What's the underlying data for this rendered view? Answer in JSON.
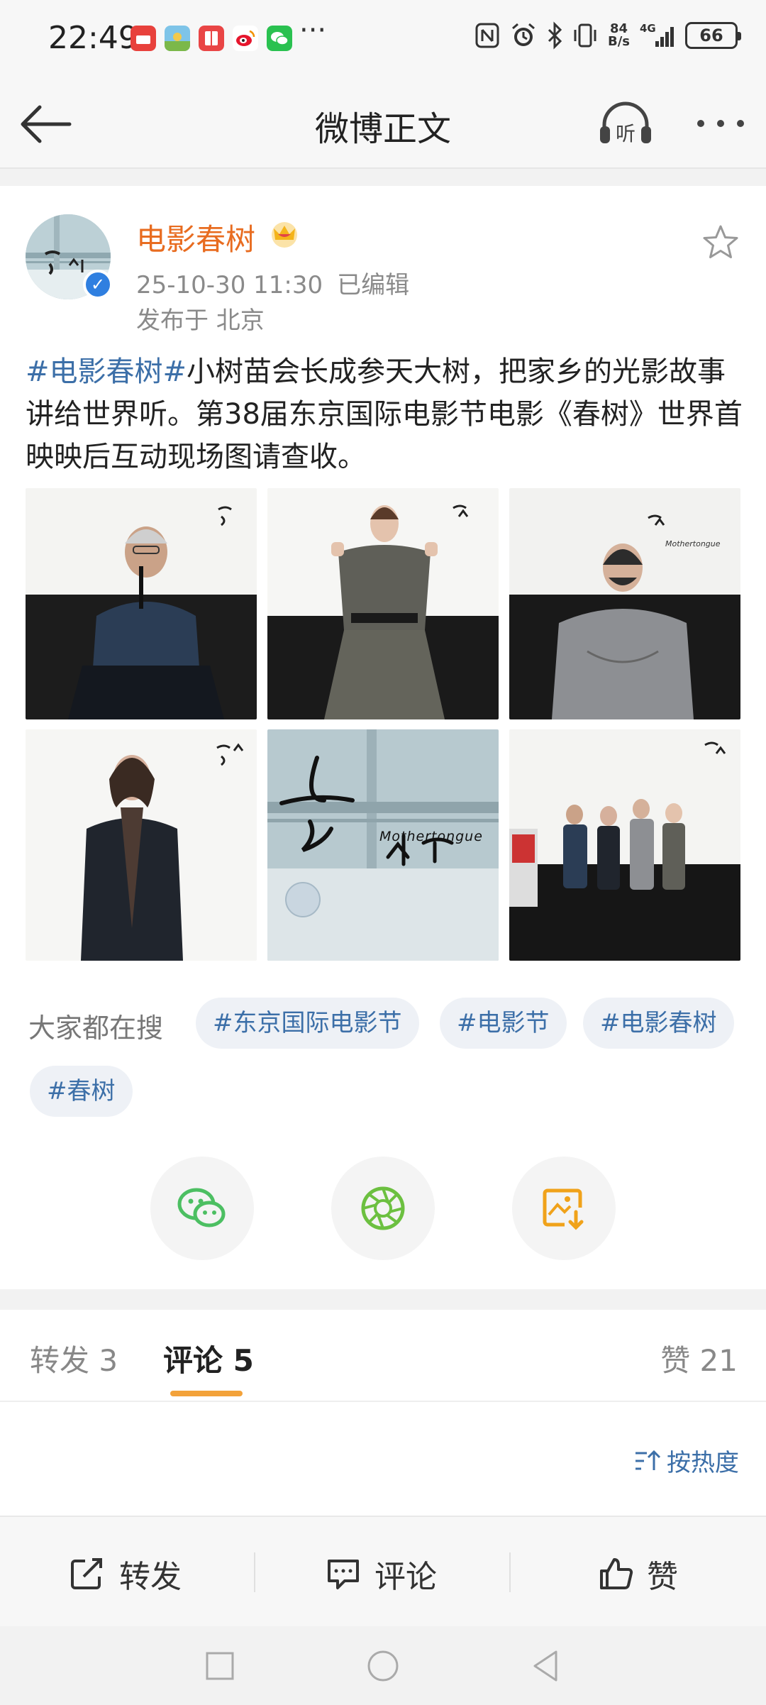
{
  "status": {
    "time": "22:49",
    "net_speed_value": "84",
    "net_speed_unit": "B/s",
    "signal": "4G",
    "battery": "66"
  },
  "nav": {
    "title": "微博正文"
  },
  "post": {
    "author": "电影春树",
    "timestamp": "25-10-30 11:30",
    "edited": "已编辑",
    "location": "发布于 北京",
    "hashtag": "#电影春树#",
    "text": "小树苗会长成参天大树，把家乡的光影故事讲给世界听。第38届东京国际电影节电影《春树》世界首映映后互动现场图请查收。",
    "poster_subtitle": "Mothertongue"
  },
  "search": {
    "label": "大家都在搜",
    "tags": [
      "#东京国际电影节",
      "#电影节",
      "#电影春树",
      "#春树"
    ]
  },
  "tabs": {
    "repost": "转发 3",
    "comment": "评论 5",
    "like": "赞 21"
  },
  "sort": {
    "label": "按热度"
  },
  "actions": {
    "repost": "转发",
    "comment": "评论",
    "like": "赞"
  },
  "colors": {
    "accent_orange": "#e86c20",
    "link_blue": "#3c6fa8",
    "tab_indicator": "#f3a23a",
    "wechat_green": "#4cbf62",
    "moments_green": "#6cc040",
    "save_orange": "#f0a21a"
  }
}
